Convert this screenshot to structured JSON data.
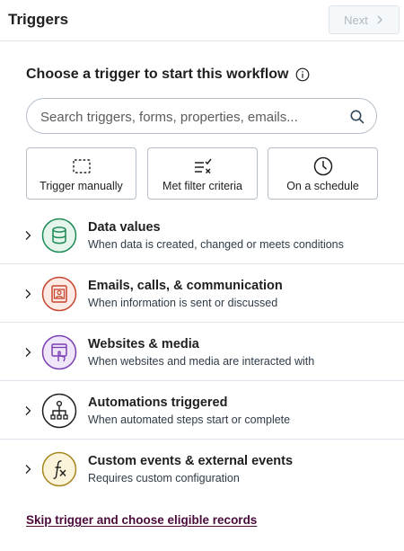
{
  "header": {
    "title": "Triggers",
    "next_label": "Next"
  },
  "section": {
    "title": "Choose a trigger to start this workflow"
  },
  "search": {
    "placeholder": "Search triggers, forms, properties, emails..."
  },
  "cards": [
    {
      "label": "Trigger manually",
      "icon": "dashed-box-icon"
    },
    {
      "label": "Met filter criteria",
      "icon": "filter-check-icon"
    },
    {
      "label": "On a schedule",
      "icon": "clock-icon"
    }
  ],
  "categories": [
    {
      "title": "Data values",
      "description": "When data is created, changed or meets conditions",
      "icon": "database-icon",
      "color": "#1e8a56",
      "bg": "#e5f5ec"
    },
    {
      "title": "Emails, calls, & communication",
      "description": "When information is sent or discussed",
      "icon": "contact-card-icon",
      "color": "#c6452f",
      "bg": "#fdeae4"
    },
    {
      "title": "Websites & media",
      "description": "When websites and media are interacted with",
      "icon": "web-touch-icon",
      "color": "#7b3fb3",
      "bg": "#f0e6fa"
    },
    {
      "title": "Automations triggered",
      "description": "When automated steps start or complete",
      "icon": "workflow-icon",
      "color": "#1f1f1f",
      "bg": "#ffffff"
    },
    {
      "title": "Custom events & external events",
      "description": "Requires custom configuration",
      "icon": "function-icon",
      "color": "#a8861f",
      "bg": "#fbf3da"
    }
  ],
  "footer": {
    "skip_label": "Skip trigger and choose eligible records"
  }
}
